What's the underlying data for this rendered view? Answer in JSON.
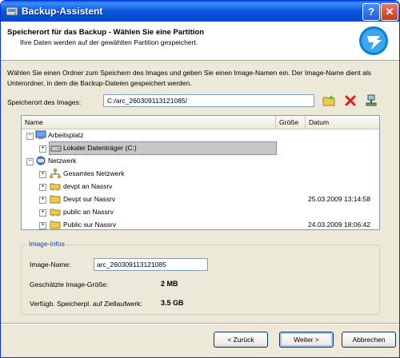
{
  "window": {
    "title": "Backup-Assistent",
    "help": "?",
    "close": "✕"
  },
  "header": {
    "title": "Speicherort für das Backup - Wählen Sie eine Partition",
    "subtitle": "Ihre Daten werden auf der gewählten Partition gespeichert."
  },
  "instruction": "Wählen Sie einen Ordner zum Speichern des Images und geben Sie einen Image-Namen ein. Der Image-Name dient als Unterordner, in dem die Backup-Dateien gespeichert werden.",
  "path": {
    "label": "Speicherort des Images:",
    "value": "C:/arc_260309113121085/"
  },
  "tree": {
    "columns": [
      "Name",
      "Größe",
      "Datum"
    ],
    "items": [
      {
        "label": "Arbeitsplatz",
        "expander": "−",
        "icon": "computer-icon"
      },
      {
        "label": "Lokaler Datenträger (C:)",
        "expander": "+",
        "icon": "drive-icon",
        "selected": true
      },
      {
        "label": "Netzwerk",
        "expander": "−",
        "icon": "network-icon"
      },
      {
        "label": "Gesamtes Netzwerk",
        "expander": "+",
        "icon": "entire-network-icon"
      },
      {
        "label": "devpt an Nassrv",
        "expander": "+",
        "icon": "network-drive-icon"
      },
      {
        "label": "Devpt sur Nassrv",
        "expander": "+",
        "icon": "folder-icon",
        "date": "25.03.2009 13:14:58"
      },
      {
        "label": "public an Nassrv",
        "expander": "+",
        "icon": "network-drive-icon"
      },
      {
        "label": "Public sur Nassrv",
        "expander": "+",
        "icon": "folder-icon",
        "date": "24.03.2009 18:06:42"
      }
    ]
  },
  "image_info": {
    "legend": "Image-Infos",
    "name_label": "Image-Name:",
    "name_value": "arc_260309113121085",
    "size_label": "Geschätzte Image-Größe:",
    "size_value": "2 MB",
    "free_label": "Verfügb. Speicherpl. auf Ziellaufwerk:",
    "free_value": "3.5 GB"
  },
  "buttons": {
    "back": "< Zurück",
    "next": "Weiter >",
    "cancel": "Abbrechen"
  }
}
